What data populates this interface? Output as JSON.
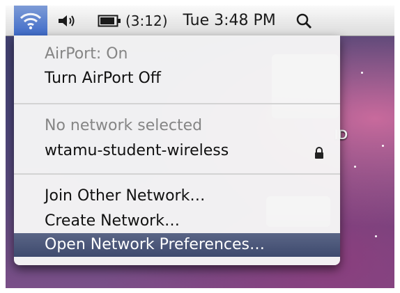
{
  "menubar": {
    "wifi_icon": "wifi-icon",
    "volume_icon": "speaker-icon",
    "battery_icon": "battery-icon",
    "battery_time": "(3:12)",
    "clock": "Tue 3:48 PM",
    "search_icon": "search-icon"
  },
  "menu": {
    "airport_status": "AirPort: On",
    "airport_toggle": "Turn AirPort Off",
    "network_status": "No network selected",
    "network_name": "wtamu-student-wireless",
    "network_lock_icon": "lock-icon",
    "join_other": "Join Other Network…",
    "create_network": "Create Network…",
    "open_prefs": "Open Network Preferences…"
  },
  "desktop": {
    "hd_label": "ID"
  },
  "colors": {
    "highlight": "#3e4a6e",
    "menu_bg": "#f6f6f6",
    "disabled_text": "#858585"
  }
}
